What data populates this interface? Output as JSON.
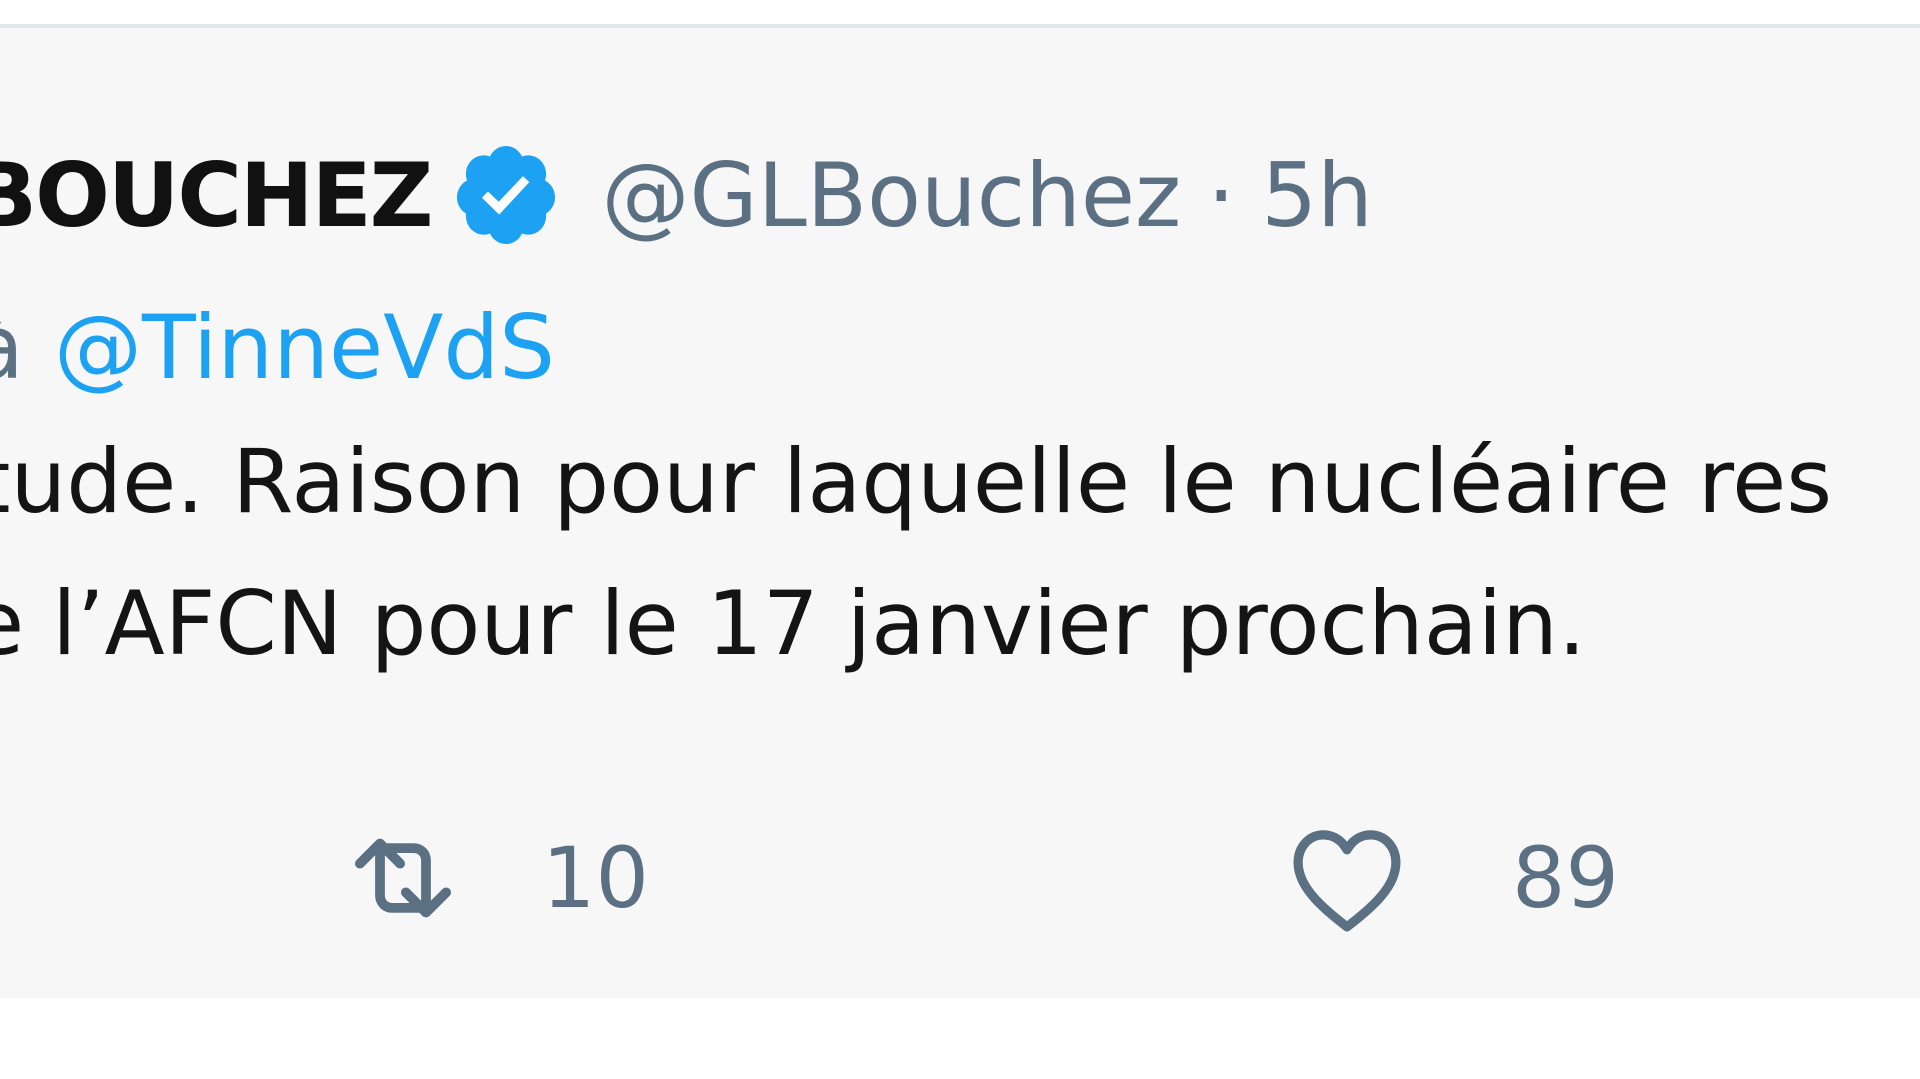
{
  "tweet": {
    "author_name": "BOUCHEZ",
    "handle": "@GLBouchez",
    "separator": "·",
    "timestamp": "5h",
    "reply_prefix": "à",
    "reply_to": "@TinneVdS",
    "body_line_1": "tude. Raison pour laquelle le nucléaire res",
    "body_line_2": "e l’AFCN pour le 17 janvier prochain.",
    "retweet_count": "10",
    "like_count": "89"
  },
  "colors": {
    "verified_blue": "#1da1f2",
    "link_blue": "#1da1f2",
    "secondary_text": "#5b7083",
    "card_background": "#f7f7f7"
  },
  "icons": [
    "verified-badge-icon",
    "retweet-icon",
    "heart-icon"
  ]
}
